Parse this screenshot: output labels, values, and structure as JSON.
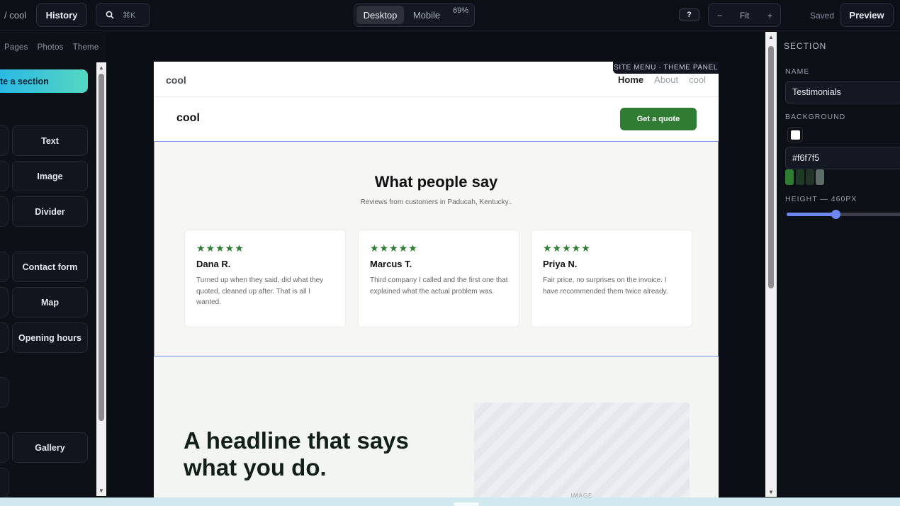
{
  "topbar": {
    "crumb": "/ cool",
    "history": "History",
    "search_shortcut": "⌘K",
    "device_desktop": "Desktop",
    "device_mobile": "Mobile",
    "zoom_pct": "69%",
    "help": "?",
    "zoom_out": "−",
    "zoom_fit": "Fit",
    "zoom_in": "+",
    "saved": "Saved",
    "preview": "Preview"
  },
  "left": {
    "tabs": [
      "Pages",
      "Photos",
      "Theme"
    ],
    "generate": "te a section",
    "tiles": [
      "Text",
      "Image",
      "Divider",
      "Contact form",
      "Map",
      "Opening hours",
      "Gallery"
    ]
  },
  "site": {
    "brand": "cool",
    "nav": [
      "Home",
      "About",
      "cool"
    ],
    "theme_tag": "SITE MENU · THEME PANEL",
    "logo": "cool",
    "cta": "Get a quote",
    "testimonials": {
      "title": "What people say",
      "subtitle": "Reviews from customers in Paducah, Kentucky..",
      "cards": [
        {
          "stars": "★★★★★",
          "name": "Dana R.",
          "text": "Turned up when they said, did what they quoted, cleaned up after. That is all I wanted."
        },
        {
          "stars": "★★★★★",
          "name": "Marcus T.",
          "text": "Third company I called and the first one that explained what the actual problem was."
        },
        {
          "stars": "★★★★★",
          "name": "Priya N.",
          "text": "Fair price, no surprises on the invoice. I have recommended them twice already."
        }
      ]
    },
    "hero": {
      "headline": "A headline that says what you do.",
      "image_label": "IMAGE"
    }
  },
  "right": {
    "section": "SECTION",
    "name_label": "NAME",
    "name_value": "Testimonials",
    "bg_label": "BACKGROUND",
    "bg_value": "#f6f7f5",
    "height_label": "HEIGHT — 460PX",
    "height_fraction": 0.41,
    "palette": [
      "#2e7d32",
      "#1f3a24",
      "#243328",
      "#5d6b66"
    ]
  }
}
